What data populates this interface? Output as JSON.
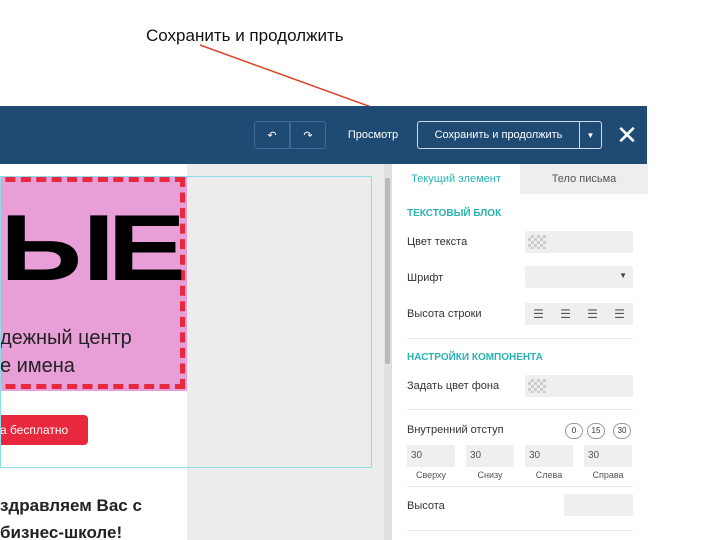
{
  "annotation": {
    "text": "Сохранить и продолжить"
  },
  "toolbar": {
    "preview_label": "Просмотр",
    "save_label": "Сохранить и продолжить"
  },
  "email_preview": {
    "big_text": "ЫЕ",
    "hero_line1": "дежный центр",
    "hero_line2": "е имена",
    "cta_label": "а бесплатно",
    "welcome_line1": "здравляем Вас с",
    "welcome_line2": "бизнес-школе!",
    "colors": {
      "hero_bg": "#e89fd8",
      "accent_red": "#e8283c"
    }
  },
  "panel": {
    "tabs": [
      "Текущий элемент",
      "Тело письма"
    ],
    "text_block_title": "ТЕКСТОВЫЙ БЛОК",
    "text_color_label": "Цвет текста",
    "font_label": "Шрифт",
    "line_height_label": "Высота строки",
    "component_settings_title": "НАСТРОЙКИ КОМПОНЕНТА",
    "bg_color_label": "Задать цвет фона",
    "padding_label": "Внутренний отступ",
    "padding_presets": [
      "0",
      "15",
      "30"
    ],
    "padding_values": [
      "30",
      "30",
      "30",
      "30"
    ],
    "padding_captions": [
      "Сверху",
      "Снизу",
      "Слева",
      "Справа"
    ],
    "height_label": "Высота"
  },
  "colors": {
    "topbar": "#1f4a74",
    "panel_accent": "#2ab3b3",
    "arrow": "#d9472b"
  }
}
